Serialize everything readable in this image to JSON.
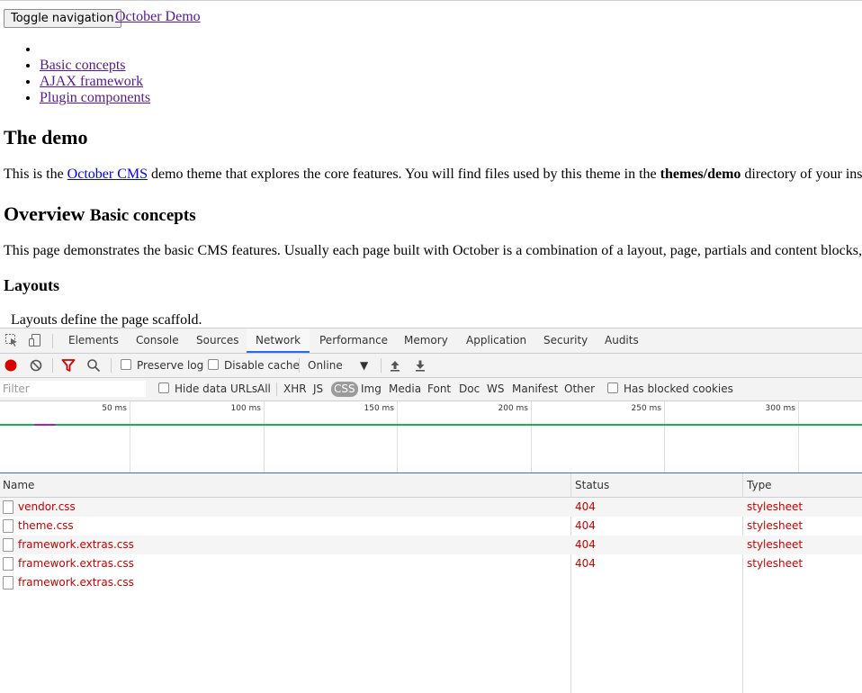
{
  "page": {
    "toggle_label": "Toggle navigation",
    "brand": "October Demo",
    "nav": [
      "",
      "Basic concepts",
      "AJAX framework",
      "Plugin components"
    ],
    "heading1": "The demo",
    "intro_pre": "This is the ",
    "intro_link": "October CMS",
    "intro_mid": " demo theme that explores the core features. You will find files used by this theme in the ",
    "intro_bold": "themes/demo",
    "intro_post": " directory of your ins",
    "heading2": "Overview",
    "heading2_small": "Basic concepts",
    "para2": "This page demonstrates the basic CMS features. Usually each page built with October is a combination of a layout, page, partials and content blocks,",
    "heading3": "Layouts",
    "para3": "Layouts define the page scaffold."
  },
  "devtools": {
    "tabs": [
      "Elements",
      "Console",
      "Sources",
      "Network",
      "Performance",
      "Memory",
      "Application",
      "Security",
      "Audits"
    ],
    "active_tab": "Network",
    "toolbar": {
      "preserve_log": "Preserve log",
      "disable_cache": "Disable cache",
      "throttle": "Online"
    },
    "filter": {
      "placeholder": "Filter",
      "hide_data_urls": "Hide data URLs",
      "types": [
        "All",
        "XHR",
        "JS",
        "CSS",
        "Img",
        "Media",
        "Font",
        "Doc",
        "WS",
        "Manifest",
        "Other"
      ],
      "active_type": "CSS",
      "has_blocked_cookies": "Has blocked cookies"
    },
    "timeline_ticks": [
      "50 ms",
      "100 ms",
      "150 ms",
      "200 ms",
      "250 ms",
      "300 ms"
    ],
    "columns": [
      "Name",
      "Status",
      "Type"
    ],
    "rows": [
      {
        "name": "vendor.css",
        "status": "404",
        "type": "stylesheet"
      },
      {
        "name": "theme.css",
        "status": "404",
        "type": "stylesheet"
      },
      {
        "name": "framework.extras.css",
        "status": "404",
        "type": "stylesheet"
      },
      {
        "name": "framework.extras.css",
        "status": "404",
        "type": "stylesheet"
      },
      {
        "name": "framework.extras.css",
        "status": "",
        "type": ""
      }
    ],
    "colors": {
      "error": "#c80000",
      "accent": "#1a73e8",
      "record": "#d50000"
    }
  }
}
